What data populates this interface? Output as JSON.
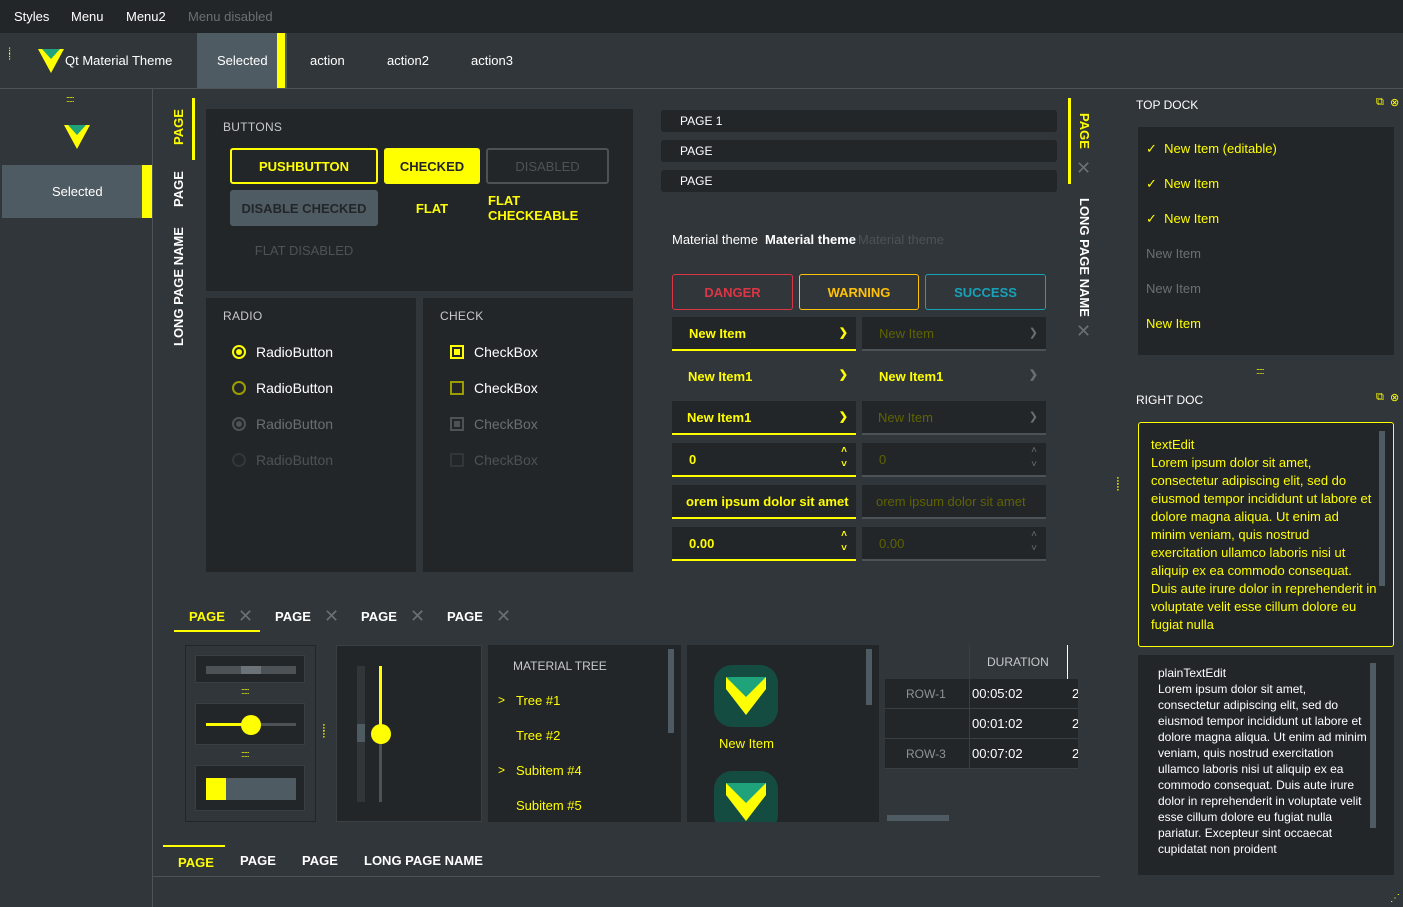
{
  "menubar": {
    "items": [
      "Styles",
      "Menu",
      "Menu2"
    ],
    "disabled_item": "Menu disabled"
  },
  "toolbar": {
    "app_title": "Qt Material Theme",
    "selected": "Selected",
    "actions": [
      "action",
      "action2",
      "action3"
    ]
  },
  "left_toolbar": {
    "selected": "Selected"
  },
  "left_tabs": [
    "PAGE",
    "PAGE",
    "LONG PAGE NAME"
  ],
  "buttons_group": {
    "title": "BUTTONS",
    "pushbutton": "PUSHBUTTON",
    "checked": "CHECKED",
    "disabled": "DISABLED",
    "disable_checked": "DISABLE CHECKED",
    "flat": "FLAT",
    "flat_checkeable": "FLAT CHECKEABLE",
    "flat_disabled": "FLAT DISABLED"
  },
  "radio_group": {
    "title": "RADIO",
    "items": [
      "RadioButton",
      "RadioButton",
      "RadioButton",
      "RadioButton"
    ]
  },
  "check_group": {
    "title": "CHECK",
    "items": [
      "CheckBox",
      "CheckBox",
      "CheckBox",
      "CheckBox"
    ]
  },
  "toolbox_pages": [
    "PAGE 1",
    "PAGE",
    "PAGE"
  ],
  "material_labels": [
    "Material theme",
    "Material theme",
    "Material theme"
  ],
  "alert_buttons": {
    "danger": "DANGER",
    "warning": "WARNING",
    "success": "SUCCESS"
  },
  "combos": {
    "new_item": "New Item",
    "new_item1": "New Item1",
    "spin_int": "0",
    "line_edit": "orem ipsum dolor sit amet",
    "spin_double": "0.00"
  },
  "right_tabs": [
    "PAGE",
    "LONG PAGE NAME"
  ],
  "top_dock": {
    "title": "TOP DOCK",
    "items": [
      "New Item (editable)",
      "New Item",
      "New Item",
      "New Item",
      "New Item",
      "New Item"
    ]
  },
  "right_dock": {
    "title": "RIGHT DOC",
    "text_edit_title": "textEdit",
    "text_edit_body": "Lorem ipsum dolor sit amet, consectetur adipiscing elit, sed do eiusmod tempor incididunt ut labore et dolore magna aliqua. Ut enim ad minim veniam, quis nostrud exercitation ullamco laboris nisi ut aliquip ex ea commodo consequat. Duis aute irure dolor in reprehenderit in voluptate velit esse cillum dolore eu fugiat nulla",
    "plain_text_title": "plainTextEdit",
    "plain_text_body": "Lorem ipsum dolor sit amet, consectetur adipiscing elit, sed do eiusmod tempor incididunt ut labore et dolore magna aliqua. Ut enim ad minim veniam, quis nostrud exercitation ullamco laboris nisi ut aliquip ex ea commodo consequat. Duis aute irure dolor in reprehenderit in voluptate velit esse cillum dolore eu fugiat nulla pariatur. Excepteur sint occaecat cupidatat non proident"
  },
  "bottom_tabs_top": [
    "PAGE",
    "PAGE",
    "PAGE",
    "PAGE"
  ],
  "tree": {
    "title": "MATERIAL TREE",
    "items": [
      "Tree #1",
      "Tree #2",
      "Subitem #4",
      "Subitem #5"
    ]
  },
  "icon_list": {
    "label": "New Item"
  },
  "table": {
    "header": "DURATION",
    "rows": [
      {
        "label": "ROW-1",
        "value": "00:05:02",
        "extra": "2"
      },
      {
        "label": "",
        "value": "00:01:02",
        "extra": "2"
      },
      {
        "label": "ROW-3",
        "value": "00:07:02",
        "extra": "2"
      }
    ]
  },
  "bottom_tabs": [
    "PAGE",
    "PAGE",
    "PAGE",
    "LONG PAGE NAME"
  ],
  "colors": {
    "accent": "#ffff00",
    "bg": "#31363b",
    "panel": "#232629",
    "danger": "#dc3545",
    "warning": "#ffc107",
    "success": "#17a2b8"
  }
}
